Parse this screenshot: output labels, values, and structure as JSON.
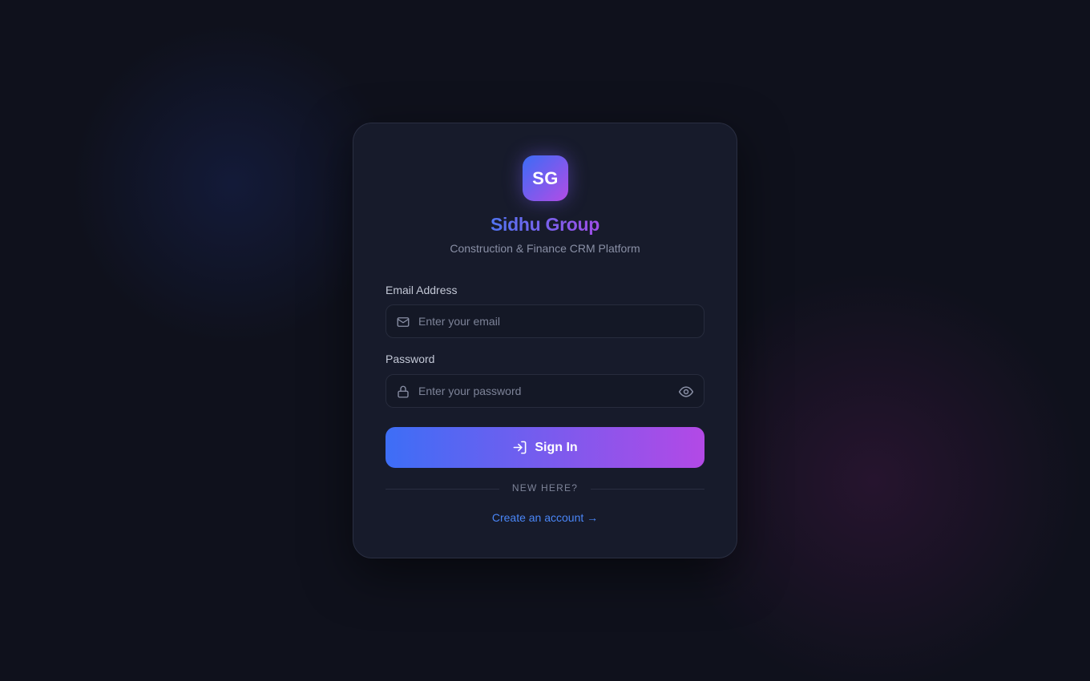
{
  "brand": {
    "logo_text": "SG",
    "name": "Sidhu Group",
    "tagline": "Construction & Finance CRM Platform"
  },
  "form": {
    "email": {
      "label": "Email Address",
      "placeholder": "Enter your email",
      "value": "",
      "icon": "mail-icon"
    },
    "password": {
      "label": "Password",
      "placeholder": "Enter your password",
      "value": "",
      "icon": "lock-icon",
      "toggle_icon": "eye-icon"
    },
    "submit_label": "Sign In",
    "submit_icon": "log-in-icon"
  },
  "divider_text": "NEW HERE?",
  "signup_link": "Create an account →",
  "colors": {
    "background": "#0f111c",
    "card": "#171b2b",
    "accent_start": "#3d6ef6",
    "accent_end": "#b349e6",
    "link": "#4a86f7"
  }
}
